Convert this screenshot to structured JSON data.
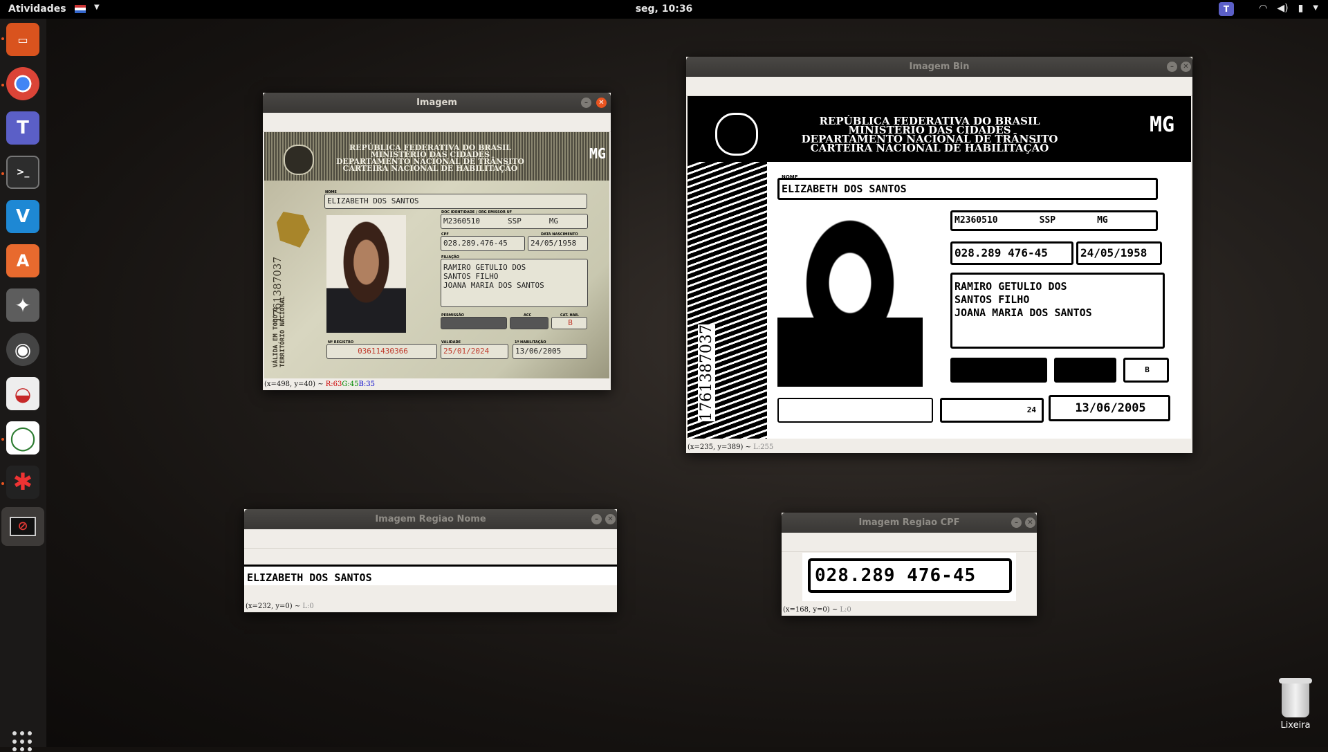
{
  "topbar": {
    "activities": "Atividades",
    "clock": "seg, 10:36"
  },
  "dock": {
    "items": [
      {
        "name": "files",
        "color": "#d9531e",
        "glyph": "▭"
      },
      {
        "name": "chrome",
        "color": "#dadada",
        "glyph": "●"
      },
      {
        "name": "teams",
        "color": "#5b5fc7",
        "glyph": "T"
      },
      {
        "name": "terminal",
        "color": "#2d2d2d",
        "glyph": ">_"
      },
      {
        "name": "vscode",
        "color": "#1e88d4",
        "glyph": "V"
      },
      {
        "name": "software",
        "color": "#e86a2e",
        "glyph": "A"
      },
      {
        "name": "settings",
        "color": "#5d5d5d",
        "glyph": "✦"
      },
      {
        "name": "rhythmbox",
        "color": "#444",
        "glyph": "◉"
      },
      {
        "name": "disk-usage",
        "color": "#c62828",
        "glyph": "◒"
      },
      {
        "name": "sync",
        "color": "#2e7d32",
        "glyph": "◯"
      },
      {
        "name": "network",
        "color": "#333",
        "glyph": "✱"
      },
      {
        "name": "image-viewer",
        "color": "#b71c1c",
        "glyph": "⊘"
      }
    ]
  },
  "windows": {
    "imagem": {
      "title": "Imagem",
      "status_coords": "(x=498, y=40) ~ ",
      "status_r": "R:63",
      "status_g": "G:45",
      "status_b": "B:35"
    },
    "imagem_bin": {
      "title": "Imagem Bin",
      "status_coords": "(x=235, y=389) ~ ",
      "status_l": "L:255"
    },
    "regiao_nome": {
      "title": "Imagem Regiao Nome",
      "status_coords": "(x=232, y=0) ~ ",
      "status_l": "L:0",
      "text": "ELIZABETH DOS SANTOS"
    },
    "regiao_cpf": {
      "title": "Imagem Regiao CPF",
      "status_coords": "(x=168, y=0) ~ ",
      "status_l": "L:0",
      "text": "028.289 476-45"
    }
  },
  "card": {
    "header_line1": "REPÚBLICA FEDERATIVA DO BRASIL",
    "header_line2": "MINISTÉRIO DAS CIDADES",
    "header_line3": "DEPARTAMENTO NACIONAL DE TRÂNSITO",
    "header_line4": "CARTEIRA NACIONAL DE HABILITAÇÃO",
    "state": "MG",
    "label_nome": "NOME",
    "nome": "ELIZABETH DOS SANTOS",
    "label_doc": "DOC IDENTIDADE / ORG EMISSOR UF",
    "doc": "M2360510",
    "doc_org": "SSP",
    "doc_uf": "MG",
    "label_cpf": "CPF",
    "cpf": "028.289.476-45",
    "cpf_bin": "028.289 476-45",
    "label_nasc": "DATA NASCIMENTO",
    "nascimento": "24/05/1958",
    "label_filiacao": "FILIAÇÃO",
    "filiacao_1": "RAMIRO GETULIO DOS",
    "filiacao_2": "SANTOS FILHO",
    "filiacao_3": "JOANA MARIA DOS SANTOS",
    "label_permissao": "PERMISSÃO",
    "label_acc": "ACC",
    "label_cat": "CAT. HAB.",
    "categoria": "B",
    "label_registro": "Nº REGISTRO",
    "registro": "03611430366",
    "label_validade": "VALIDADE",
    "validade": "25/01/2024",
    "validade_bin": "24",
    "label_hab": "1ª HABILITAÇÃO",
    "primeira_hab": "13/06/2005",
    "side_number": "1761387037",
    "side_text": "VÁLIDA EM TODO O TERRITÓRIO NACIONAL"
  },
  "trash": {
    "label": "Lixeira"
  }
}
